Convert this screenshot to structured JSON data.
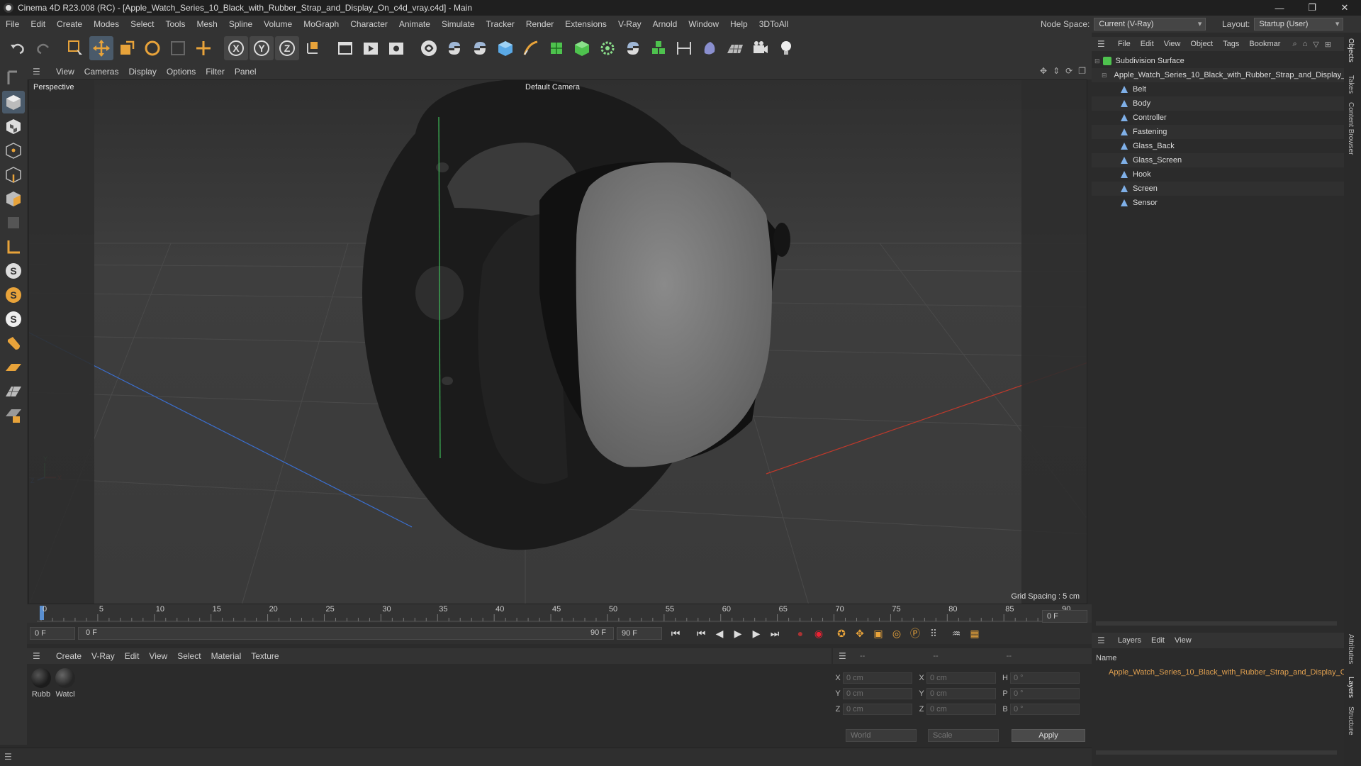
{
  "titlebar": {
    "title": "Cinema 4D R23.008 (RC) - [Apple_Watch_Series_10_Black_with_Rubber_Strap_and_Display_On_c4d_vray.c4d] - Main",
    "minimize": "—",
    "maximize": "❐",
    "close": "✕"
  },
  "menubar": {
    "items": [
      "File",
      "Edit",
      "Create",
      "Modes",
      "Select",
      "Tools",
      "Mesh",
      "Spline",
      "Volume",
      "MoGraph",
      "Character",
      "Animate",
      "Simulate",
      "Tracker",
      "Render",
      "Extensions",
      "V-Ray",
      "Arnold",
      "Window",
      "Help",
      "3DToAll"
    ],
    "node_space_label": "Node Space:",
    "node_space_value": "Current (V-Ray)",
    "layout_label": "Layout:",
    "layout_value": "Startup (User)"
  },
  "viewport_menu": {
    "items": [
      "View",
      "Cameras",
      "Display",
      "Options",
      "Filter",
      "Panel"
    ]
  },
  "viewport": {
    "projection": "Perspective",
    "camera": "Default Camera",
    "grid_spacing": "Grid Spacing : 5 cm"
  },
  "timeline": {
    "ticks": [
      "0",
      "5",
      "10",
      "15",
      "20",
      "25",
      "30",
      "35",
      "40",
      "45",
      "50",
      "55",
      "60",
      "65",
      "70",
      "75",
      "80",
      "85",
      "90"
    ],
    "current_frame_field": "0 F",
    "start_frame": "0 F",
    "range_start": "0 F",
    "range_end": "90 F",
    "end_frame": "90 F",
    "right_frame_field": "0 F"
  },
  "material_menu": {
    "items": [
      "Create",
      "V-Ray",
      "Edit",
      "View",
      "Select",
      "Material",
      "Texture"
    ]
  },
  "materials": [
    {
      "label": "Rubb",
      "color": "#1c1c1c"
    },
    {
      "label": "Watcl",
      "color": "#262626"
    }
  ],
  "coordinates": {
    "header_dashes": [
      "--",
      "--",
      "--"
    ],
    "rows": [
      {
        "a1": "X",
        "v1": "0 cm",
        "a2": "X",
        "v2": "0 cm",
        "a3": "H",
        "v3": "0 °"
      },
      {
        "a1": "Y",
        "v1": "0 cm",
        "a2": "Y",
        "v2": "0 cm",
        "a3": "P",
        "v3": "0 °"
      },
      {
        "a1": "Z",
        "v1": "0 cm",
        "a2": "Z",
        "v2": "0 cm",
        "a3": "B",
        "v3": "0 °"
      }
    ],
    "space": "World",
    "mode": "Scale",
    "apply": "Apply"
  },
  "objects_menu": {
    "items": [
      "File",
      "Edit",
      "View",
      "Object",
      "Tags",
      "Bookmar"
    ]
  },
  "object_tree": [
    {
      "name": "Subdivision Surface",
      "level": 0,
      "icon": "subdivision-icon"
    },
    {
      "name": "Apple_Watch_Series_10_Black_with_Rubber_Strap_and_Display_O",
      "level": 1,
      "icon": "null-object-icon"
    },
    {
      "name": "Belt",
      "level": 2,
      "icon": "polygon-object-icon"
    },
    {
      "name": "Body",
      "level": 2,
      "icon": "polygon-object-icon"
    },
    {
      "name": "Controller",
      "level": 2,
      "icon": "polygon-object-icon"
    },
    {
      "name": "Fastening",
      "level": 2,
      "icon": "polygon-object-icon"
    },
    {
      "name": "Glass_Back",
      "level": 2,
      "icon": "polygon-object-icon"
    },
    {
      "name": "Glass_Screen",
      "level": 2,
      "icon": "polygon-object-icon"
    },
    {
      "name": "Hook",
      "level": 2,
      "icon": "polygon-object-icon"
    },
    {
      "name": "Screen",
      "level": 2,
      "icon": "polygon-object-icon"
    },
    {
      "name": "Sensor",
      "level": 2,
      "icon": "polygon-object-icon"
    }
  ],
  "layers_menu": {
    "items": [
      "Layers",
      "Edit",
      "View"
    ]
  },
  "layers": {
    "column": "Name",
    "rows": [
      {
        "name": "Apple_Watch_Series_10_Black_with_Rubber_Strap_and_Display_O",
        "color": "#d2622a"
      }
    ]
  },
  "side_tabs": {
    "top": [
      "Objects",
      "Takes",
      "Content Browser"
    ],
    "bottom": [
      "Attributes",
      "Layers",
      "Structure"
    ]
  },
  "colors": {
    "accent_green": "#4ec24e",
    "axis_x": "#c0392b",
    "axis_z": "#3b6fd0",
    "axis_y": "#3fbf5a",
    "selection": "#e8a33a"
  }
}
